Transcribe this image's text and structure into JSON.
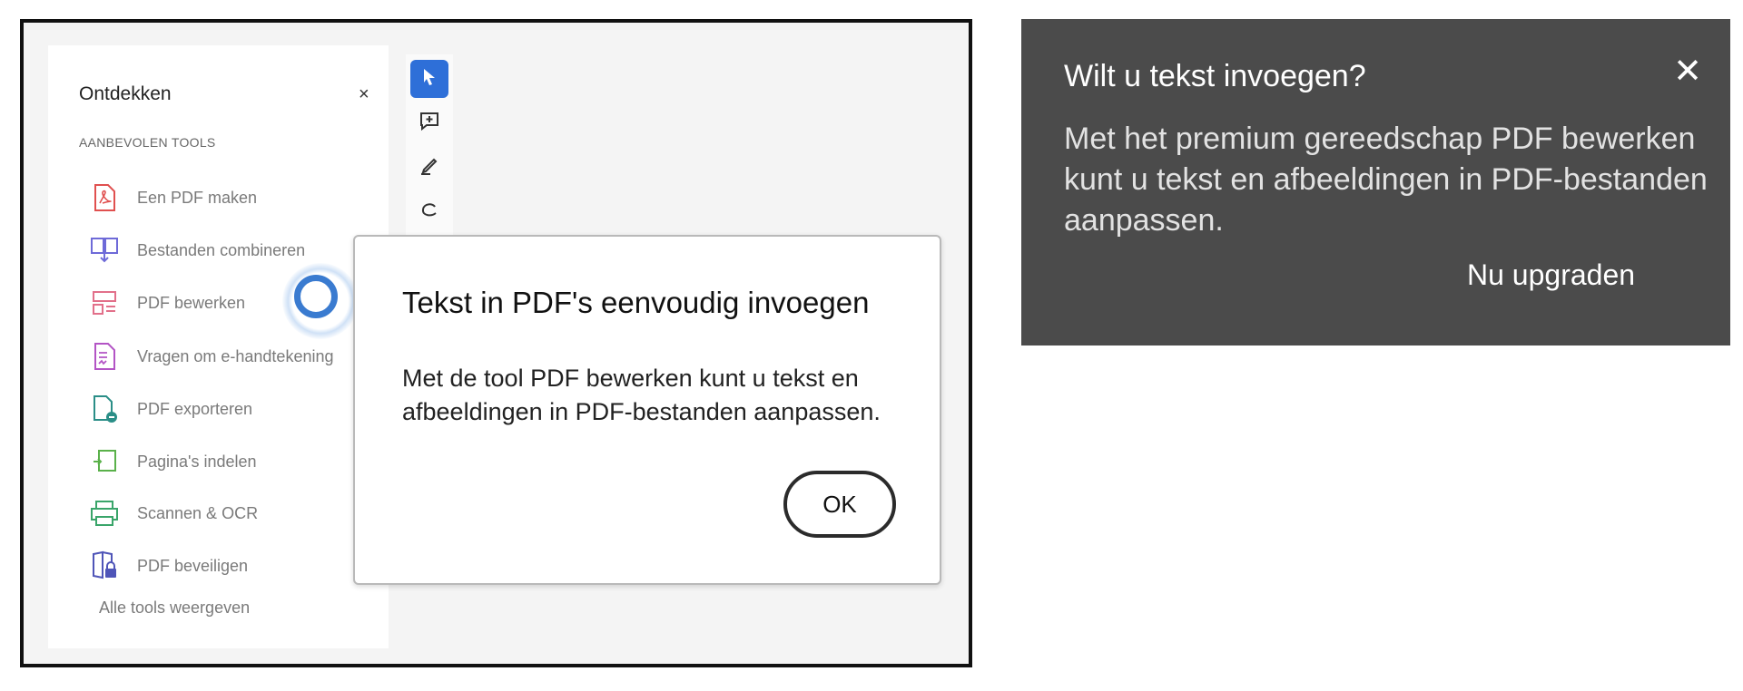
{
  "panel": {
    "title": "Ontdekken",
    "close_glyph": "×",
    "section_label": "AANBEVOLEN TOOLS",
    "tools": [
      {
        "label": "Een PDF maken",
        "icon": "create-pdf-icon",
        "color": "#e0504f"
      },
      {
        "label": "Bestanden combineren",
        "icon": "combine-files-icon",
        "color": "#6e6ad8"
      },
      {
        "label": "PDF bewerken",
        "icon": "edit-pdf-icon",
        "color": "#e2708a"
      },
      {
        "label": "Vragen om e-handtekening",
        "icon": "request-signature-icon",
        "color": "#b354c5"
      },
      {
        "label": "PDF exporteren",
        "icon": "export-pdf-icon",
        "color": "#2a8e87"
      },
      {
        "label": "Pagina's indelen",
        "icon": "organize-pages-icon",
        "color": "#5ab14a"
      },
      {
        "label": "Scannen & OCR",
        "icon": "scan-ocr-icon",
        "color": "#3aa56a"
      },
      {
        "label": "PDF beveiligen",
        "icon": "protect-pdf-icon",
        "color": "#4f55b8"
      }
    ],
    "all_tools_label": "Alle tools weergeven"
  },
  "toolbar": {
    "buttons": [
      "select-cursor-icon",
      "add-comment-icon",
      "highlight-pen-icon",
      "draw-freehand-icon"
    ],
    "accent": "#2e6fd8"
  },
  "dialog": {
    "title": "Tekst in PDF's eenvoudig invoegen",
    "body": "Met de tool PDF bewerken kunt u tekst en afbeeldingen in PDF-bestanden aanpassen.",
    "ok_label": "OK"
  },
  "tooltip": {
    "title": "Wilt u tekst invoegen?",
    "close_glyph": "✕",
    "body": "Met het premium gereedschap PDF bewerken kunt u tekst en afbeeldingen in PDF-bestanden aanpassen.",
    "link_label": "Nu upgraden",
    "background": "#4b4b4b"
  }
}
